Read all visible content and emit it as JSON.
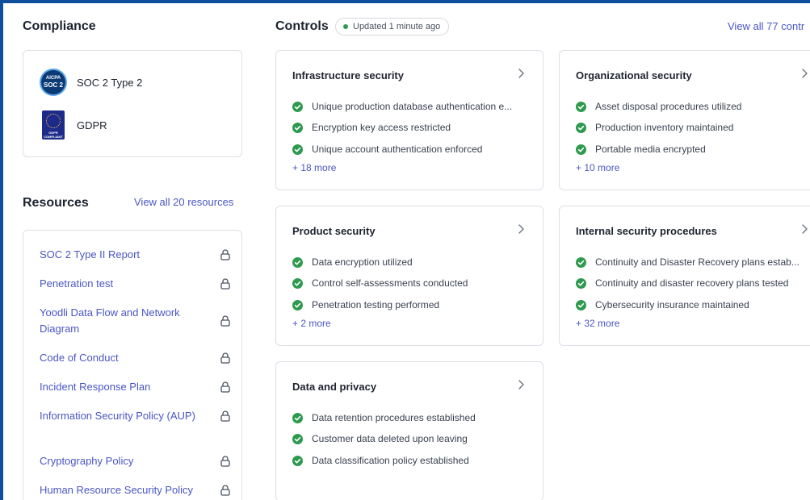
{
  "compliance": {
    "title": "Compliance",
    "items": [
      {
        "label": "SOC 2 Type 2",
        "badge_text": [
          "AICPA",
          "SOC 2"
        ],
        "icon": "soc2-badge-icon"
      },
      {
        "label": "GDPR",
        "badge_text": [
          "GDPR",
          "COMPLIANT"
        ],
        "icon": "gdpr-badge-icon"
      }
    ]
  },
  "resources": {
    "title": "Resources",
    "view_all": "View all 20 resources",
    "items": [
      {
        "name": "SOC 2 Type II Report"
      },
      {
        "name": "Penetration test"
      },
      {
        "name": "Yoodli Data Flow and Network Diagram"
      },
      {
        "name": "Code of Conduct"
      },
      {
        "name": "Incident Response Plan"
      },
      {
        "name": "Information Security Policy (AUP)"
      },
      {
        "name": "Cryptography Policy"
      },
      {
        "name": "Human Resource Security Policy"
      }
    ]
  },
  "controls": {
    "title": "Controls",
    "updated": "Updated 1 minute ago",
    "view_all": "View all 77 contr",
    "categories": [
      {
        "title": "Infrastructure security",
        "items": [
          "Unique production database authentication e...",
          "Encryption key access restricted",
          "Unique account authentication enforced"
        ],
        "more": "+ 18 more"
      },
      {
        "title": "Organizational security",
        "items": [
          "Asset disposal procedures utilized",
          "Production inventory maintained",
          "Portable media encrypted"
        ],
        "more": "+ 10 more"
      },
      {
        "title": "Product security",
        "items": [
          "Data encryption utilized",
          "Control self-assessments conducted",
          "Penetration testing performed"
        ],
        "more": "+ 2 more"
      },
      {
        "title": "Internal security procedures",
        "items": [
          "Continuity and Disaster Recovery plans estab...",
          "Continuity and disaster recovery plans tested",
          "Cybersecurity insurance maintained"
        ],
        "more": "+ 32 more"
      },
      {
        "title": "Data and privacy",
        "items": [
          "Data retention procedures established",
          "Customer data deleted upon leaving",
          "Data classification policy established"
        ],
        "more": ""
      }
    ]
  },
  "colors": {
    "accent": "#4a56c4",
    "check_green": "#2e9a4e",
    "frame_border": "#0d4f9c"
  }
}
